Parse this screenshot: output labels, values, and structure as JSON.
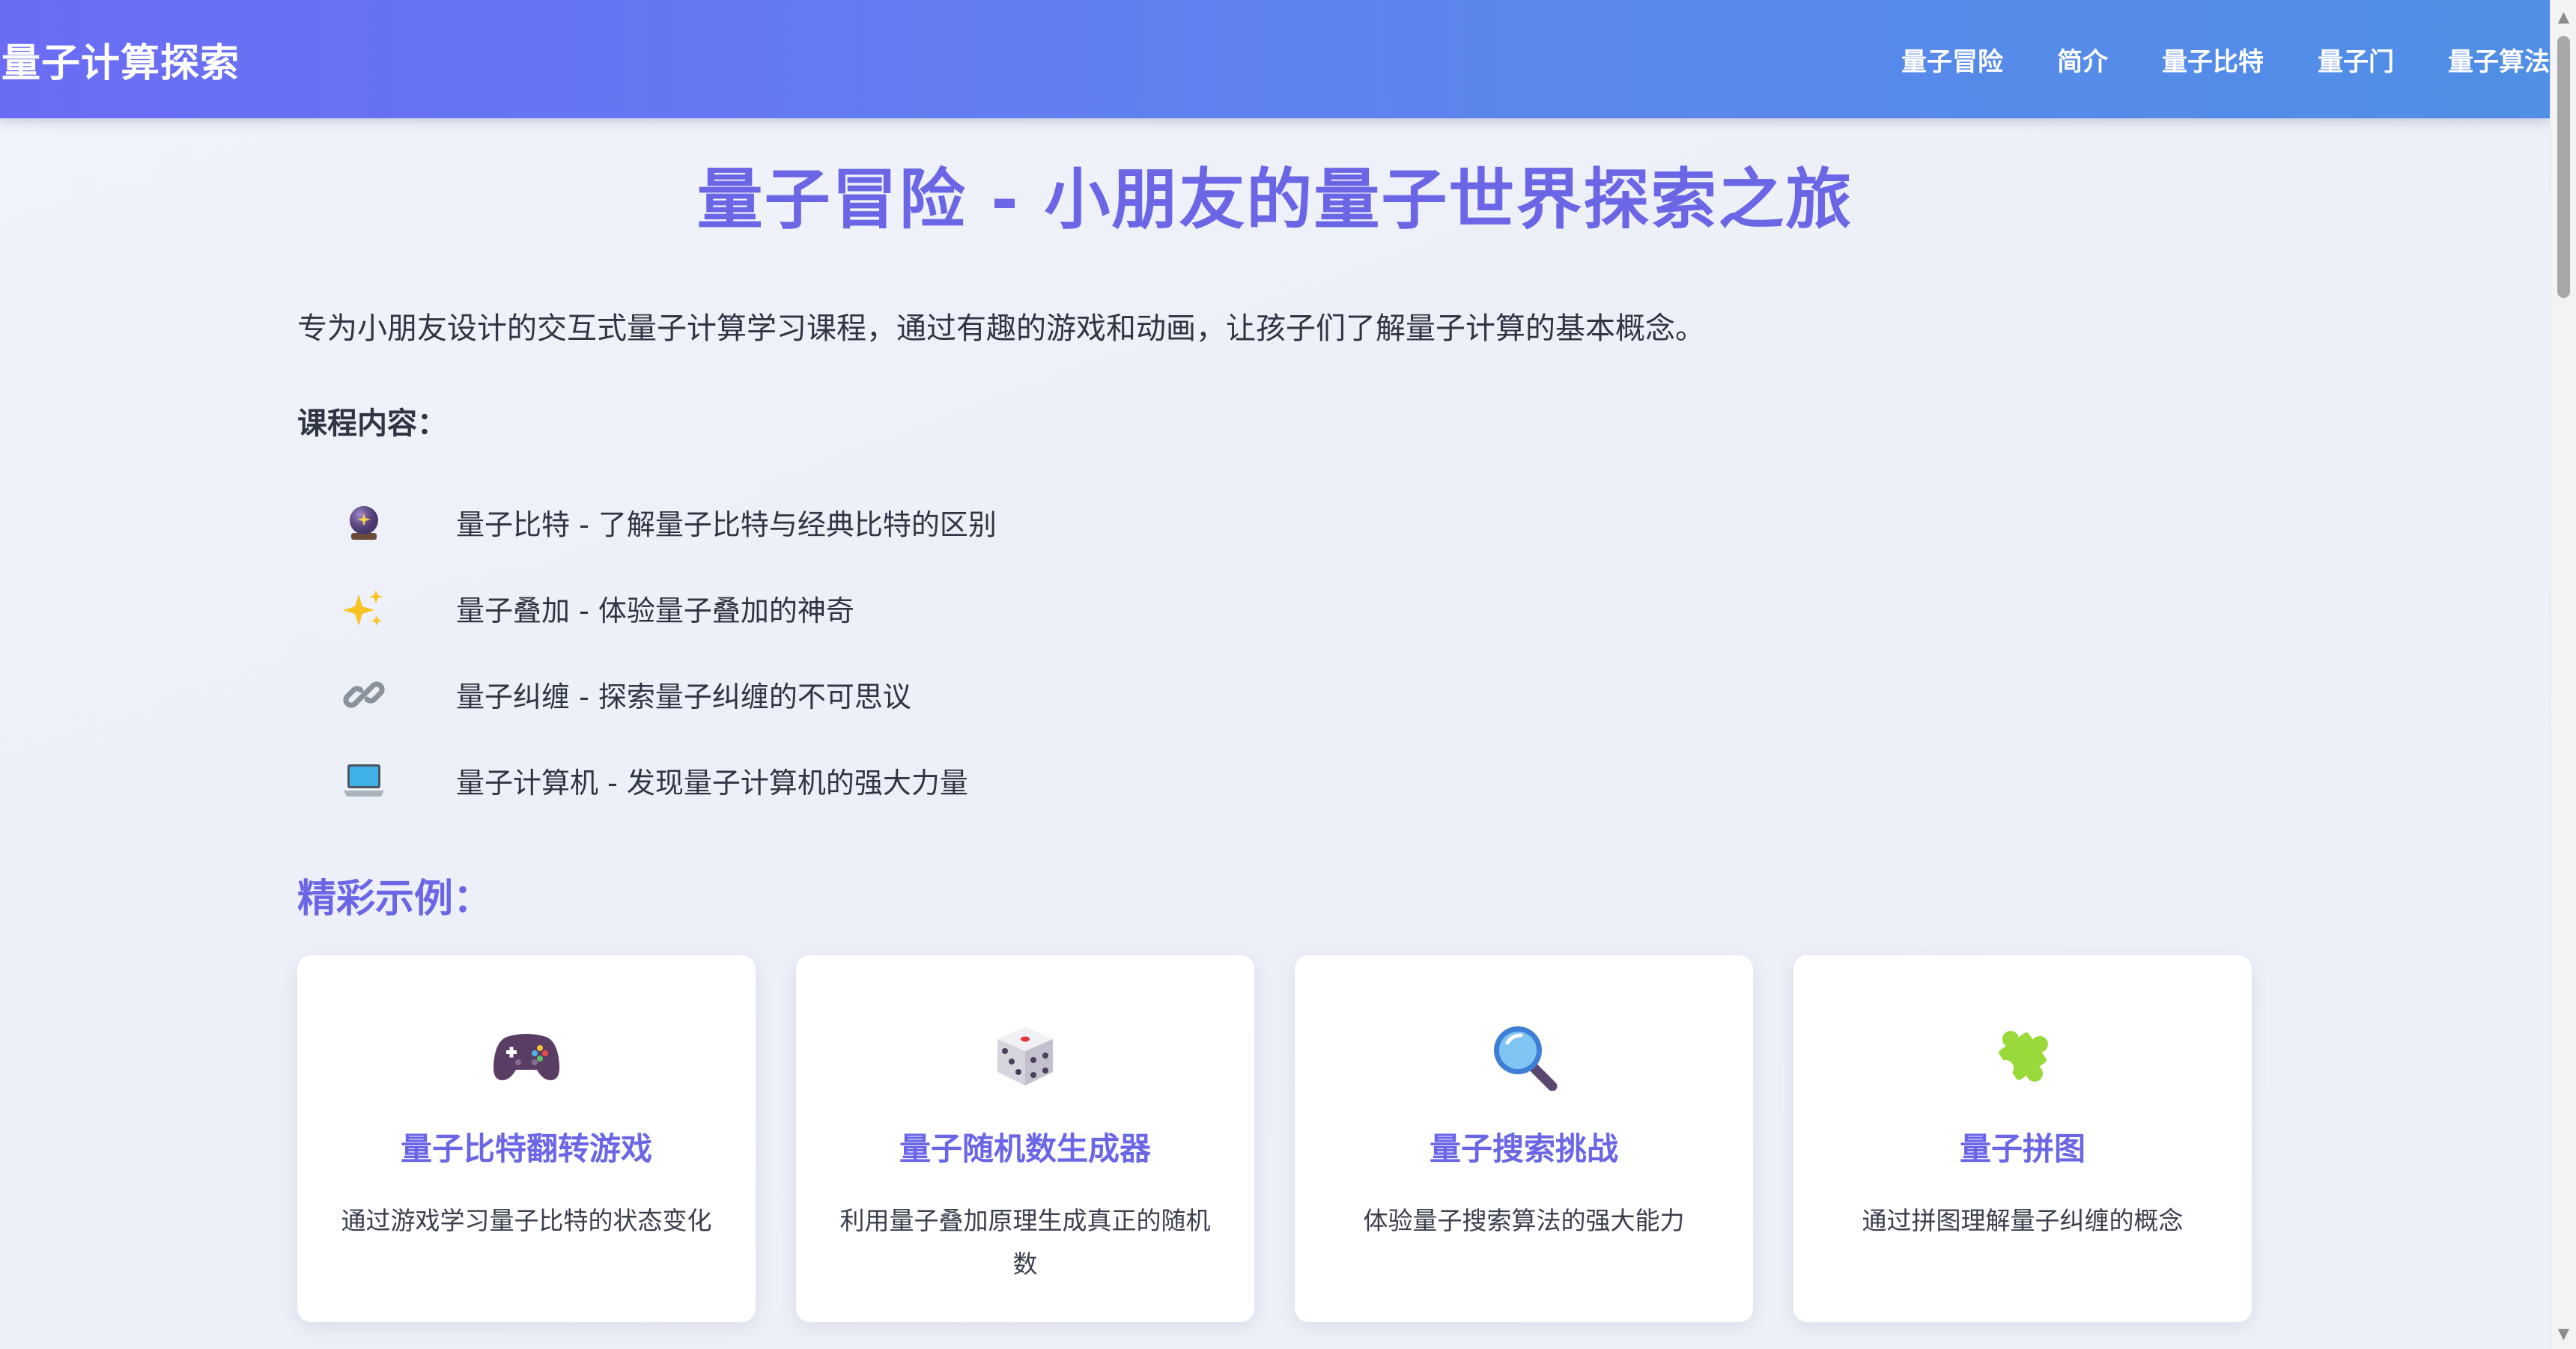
{
  "header": {
    "logo": "量子计算探索",
    "nav": [
      "量子冒险",
      "简介",
      "量子比特",
      "量子门",
      "量子算法"
    ]
  },
  "main": {
    "title": "量子冒险 - 小朋友的量子世界探索之旅",
    "intro": "专为小朋友设计的交互式量子计算学习课程，通过有趣的游戏和动画，让孩子们了解量子计算的基本概念。",
    "course_label": "课程内容：",
    "course_items": [
      {
        "icon": "crystal-ball-icon",
        "text": "量子比特 - 了解量子比特与经典比特的区别"
      },
      {
        "icon": "sparkles-icon",
        "text": "量子叠加 - 体验量子叠加的神奇"
      },
      {
        "icon": "link-icon",
        "text": "量子纠缠 - 探索量子纠缠的不可思议"
      },
      {
        "icon": "laptop-icon",
        "text": "量子计算机 - 发现量子计算机的强大力量"
      }
    ],
    "examples_title": "精彩示例：",
    "examples": [
      {
        "icon": "game-controller-icon",
        "title": "量子比特翻转游戏",
        "desc": "通过游戏学习量子比特的状态变化"
      },
      {
        "icon": "dice-icon",
        "title": "量子随机数生成器",
        "desc": "利用量子叠加原理生成真正的随机数"
      },
      {
        "icon": "magnifier-icon",
        "title": "量子搜索挑战",
        "desc": "体验量子搜索算法的强大能力"
      },
      {
        "icon": "puzzle-icon",
        "title": "量子拼图",
        "desc": "通过拼图理解量子纠缠的概念"
      }
    ]
  },
  "colors": {
    "accent": "#6a66e6",
    "header_start": "#6b6cf5",
    "header_end": "#4f8fe6",
    "background": "#eef1f8"
  }
}
